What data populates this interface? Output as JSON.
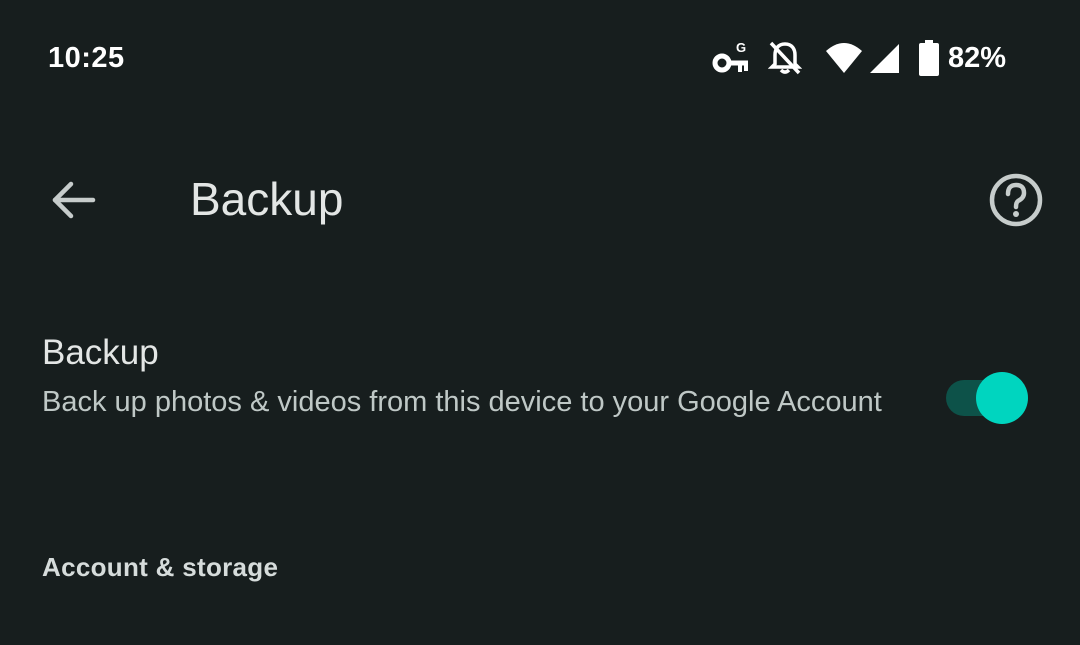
{
  "status_bar": {
    "time": "10:25",
    "battery_percent": "82%",
    "icons": [
      "vpn-key-icon",
      "notifications-off-icon",
      "wifi-icon",
      "cell-signal-icon",
      "battery-icon"
    ]
  },
  "app_bar": {
    "title": "Backup",
    "back_icon": "arrow-back-icon",
    "help_icon": "help-icon"
  },
  "backup_setting": {
    "title": "Backup",
    "description": "Back up photos & videos from this device to your Google Account",
    "enabled": true
  },
  "sections": {
    "account_storage_header": "Account & storage"
  },
  "colors": {
    "background": "#171e1e",
    "accent": "#00d5bf",
    "toggle_track": "#0d5249",
    "primary_text": "#e3e6e5",
    "secondary_text": "#bfc8c6"
  }
}
